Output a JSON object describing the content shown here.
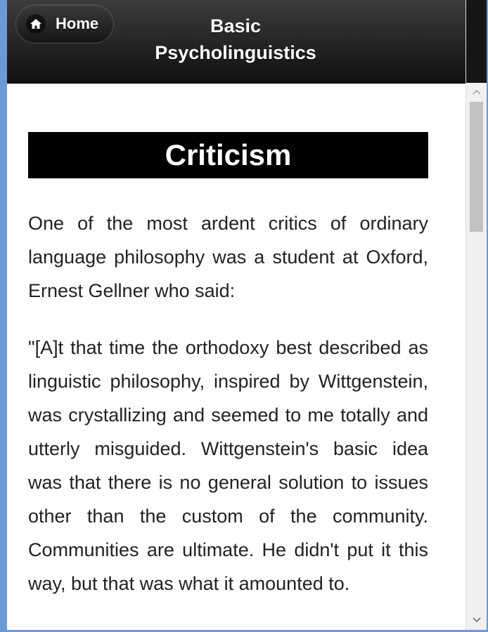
{
  "header": {
    "home_label": "Home",
    "title": "Basic Psycholinguistics"
  },
  "content": {
    "heading": "Criticism",
    "paragraphs": [
      "One of the most ardent critics of ordinary language philosophy was a student at Oxford, Ernest Gellner who said:",
      "\"[A]t that time the orthodoxy best described as linguistic philosophy, inspired by Wittgenstein, was crystallizing and seemed to me totally and utterly misguided. Wittgenstein's basic idea was that there is no general solution to issues other than the custom of the community. Communities are ultimate. He didn't put it this way, but that was what it amounted to."
    ]
  },
  "icons": {
    "home": "home-icon",
    "scroll_up": "chevron-up-icon",
    "scroll_down": "chevron-down-icon"
  }
}
